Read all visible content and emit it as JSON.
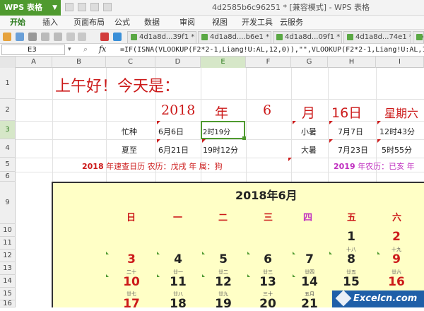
{
  "app": {
    "logo": "WPS 表格",
    "title": "4d2585b6c96251 * [兼容模式] - WPS 表格"
  },
  "menu": [
    "开始",
    "插入",
    "页面布局",
    "公式",
    "数据",
    "审阅",
    "视图",
    "开发工具",
    "云服务"
  ],
  "tabs": [
    "4d1a8d...39f1 *",
    "4d1a8d....b6e1 *",
    "4d1a8d...09f1 *",
    "4d1a8d...74e1 *",
    "4d1a8d..."
  ],
  "formula_bar": {
    "namebox": "E3",
    "fx": "fx",
    "formula": "=IF(ISNA(VLOOKUP(F2*2-1,Liang!U:AL,12,0)),\"\",VLOOKUP(F2*2-1,Liang!U:AL,1"
  },
  "columns": [
    "A",
    "B",
    "C",
    "D",
    "E",
    "F",
    "G",
    "H",
    "I"
  ],
  "rows": [
    "1",
    "2",
    "3",
    "4",
    "5",
    "6",
    "9",
    "10",
    "11",
    "12",
    "13",
    "14",
    "15",
    "16"
  ],
  "sheet": {
    "greeting": "上午好！今天是：",
    "year": "2018",
    "year_label": "年",
    "month": "6",
    "month_label": "月",
    "day": "16日",
    "weekday": "星期六",
    "term1": "忙种",
    "term1_date": "6月6日",
    "term1_time": "2时19分",
    "term2": "小暑",
    "term2_date": "7月7日",
    "term2_time": "12时43分",
    "term3": "夏至",
    "term3_date": "6月21日",
    "term3_time": "19时12分",
    "term4": "大暑",
    "term4_date": "7月23日",
    "term4_time": "5时55分",
    "row5_left_year": "2018",
    "row5_left_text": " 年速查日历   农历：戊戌 年   属：狗",
    "row5_right_year": "2019",
    "row5_right_text": " 年农历：已亥 年"
  },
  "calendar": {
    "title": "2018年6月",
    "weekdays": [
      "日",
      "一",
      "二",
      "三",
      "四",
      "五",
      "六"
    ],
    "week1": [
      {
        "day": "1",
        "lunar": "十八"
      },
      {
        "day": "2",
        "lunar": "十九"
      }
    ],
    "week2": [
      {
        "day": "3",
        "lunar": "二十"
      },
      {
        "day": "4",
        "lunar": "廿一"
      },
      {
        "day": "5",
        "lunar": "廿二"
      },
      {
        "day": "6",
        "lunar": "廿三"
      },
      {
        "day": "7",
        "lunar": "廿四"
      },
      {
        "day": "8",
        "lunar": "廿五"
      },
      {
        "day": "9",
        "lunar": "廿六"
      }
    ],
    "week3": [
      {
        "day": "10",
        "lunar": "廿七"
      },
      {
        "day": "11",
        "lunar": "廿八"
      },
      {
        "day": "12",
        "lunar": "廿九"
      },
      {
        "day": "13",
        "lunar": "三十"
      },
      {
        "day": "14",
        "lunar": "五月"
      },
      {
        "day": "15",
        "lunar": ""
      },
      {
        "day": "16",
        "lunar": ""
      }
    ],
    "week4": [
      "17",
      "18",
      "19",
      "20",
      "21"
    ]
  },
  "watermark": "Excelcn.com"
}
